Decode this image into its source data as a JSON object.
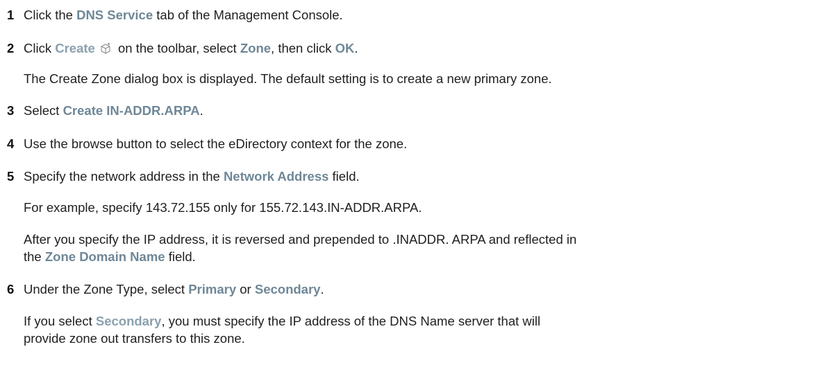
{
  "steps": [
    {
      "num": "1",
      "parts": [
        {
          "t": "Click the "
        },
        {
          "t": "DNS Service",
          "ui": true
        },
        {
          "t": " tab of the Management Console."
        }
      ]
    },
    {
      "num": "2",
      "parts": [
        {
          "t": "Click "
        },
        {
          "t": "Create",
          "ui": true
        },
        {
          "icon": "create-cube-icon"
        },
        {
          "t": " on the toolbar, select "
        },
        {
          "t": "Zone",
          "ui": true
        },
        {
          "t": ", then click "
        },
        {
          "t": "OK",
          "ui": true
        },
        {
          "t": "."
        }
      ],
      "notes": [
        "The Create Zone dialog box is displayed. The default setting is to create a new primary zone."
      ]
    },
    {
      "num": "3",
      "parts": [
        {
          "t": "Select "
        },
        {
          "t": "Create IN-ADDR.ARPA",
          "ui": true
        },
        {
          "t": "."
        }
      ]
    },
    {
      "num": "4",
      "parts": [
        {
          "t": "Use the browse button to select the eDirectory context for the zone."
        }
      ]
    },
    {
      "num": "5",
      "parts": [
        {
          "t": "Specify the network address in the "
        },
        {
          "t": "Network Address",
          "ui": true
        },
        {
          "t": " field."
        }
      ],
      "notes": [
        "For example, specify 143.72.155 only for 155.72.143.IN-ADDR.ARPA."
      ],
      "wrapped_note": {
        "line1": "After you specify the IP address, it is reversed and prepended to .INADDR. ARPA and reflected in",
        "line2_pre": "the ",
        "line2_ui": "Zone Domain Name",
        "line2_post": " field."
      }
    },
    {
      "num": "6",
      "parts": [
        {
          "t": "Under the Zone Type, select "
        },
        {
          "t": "Primary",
          "ui": true
        },
        {
          "t": " or "
        },
        {
          "t": "Secondary",
          "ui": true
        },
        {
          "t": "."
        }
      ],
      "final_note": {
        "line1_pre": "If you select ",
        "line1_ui": "Secondary",
        "line1_post": ", you must specify the IP address of the DNS Name server that will",
        "line2": "provide zone out transfers to this zone."
      }
    }
  ]
}
